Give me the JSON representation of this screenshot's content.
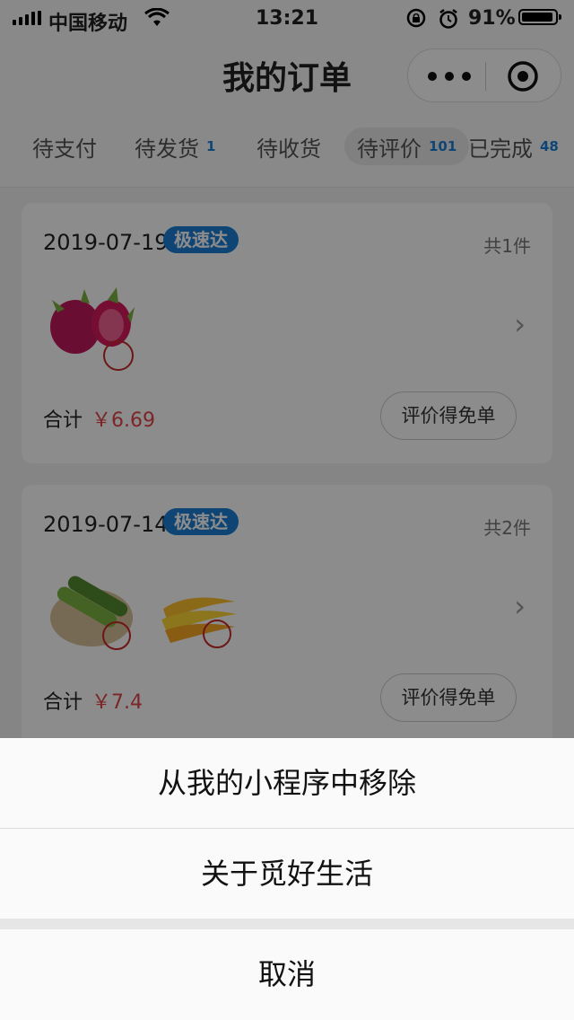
{
  "status_bar": {
    "carrier": "中国移动",
    "time": "13:21",
    "battery_pct": "91%"
  },
  "nav": {
    "title": "我的订单",
    "more_icon": "more-dots-icon",
    "close_icon": "target-icon"
  },
  "tabs": [
    {
      "label": "待支付",
      "badge": ""
    },
    {
      "label": "待发货",
      "badge": "1"
    },
    {
      "label": "待收货",
      "badge": ""
    },
    {
      "label": "待评价",
      "badge": "101"
    },
    {
      "label": "已完成",
      "badge": "48"
    }
  ],
  "orders": [
    {
      "date": "2019-07-19",
      "tag": "极速达",
      "count": "共1件",
      "total_label": "合计",
      "total": "￥6.69",
      "action": "评价得免单",
      "items": [
        "dragon-fruit"
      ]
    },
    {
      "date": "2019-07-14",
      "tag": "极速达",
      "count": "共2件",
      "total_label": "合计",
      "total": "￥7.4",
      "action": "评价得免单",
      "items": [
        "cucumber",
        "banana"
      ]
    }
  ],
  "action_sheet": {
    "remove": "从我的小程序中移除",
    "about": "关于觅好生活",
    "cancel": "取消"
  },
  "colors": {
    "accent": "#1a7ed6",
    "price": "#e2464b"
  }
}
